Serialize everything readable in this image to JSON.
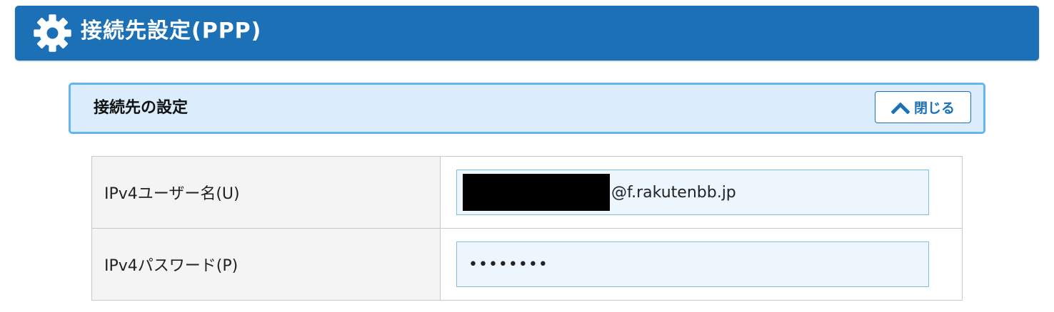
{
  "header": {
    "title": "接続先設定(PPP)",
    "icon": "gear-icon",
    "background_color": "#1b70b6"
  },
  "section": {
    "title": "接続先の設定",
    "close_button_label": "閉じる",
    "close_icon": "chevron-up-icon",
    "background_color": "#dbecfc",
    "border_color": "#66b6ee"
  },
  "fields": {
    "username": {
      "label": "IPv4ユーザー名(U)",
      "value_redacted": true,
      "domain_suffix": "@f.rakutenbb.jp"
    },
    "password": {
      "label": "IPv4パスワード(P)",
      "masked_value": "••••••••"
    }
  }
}
